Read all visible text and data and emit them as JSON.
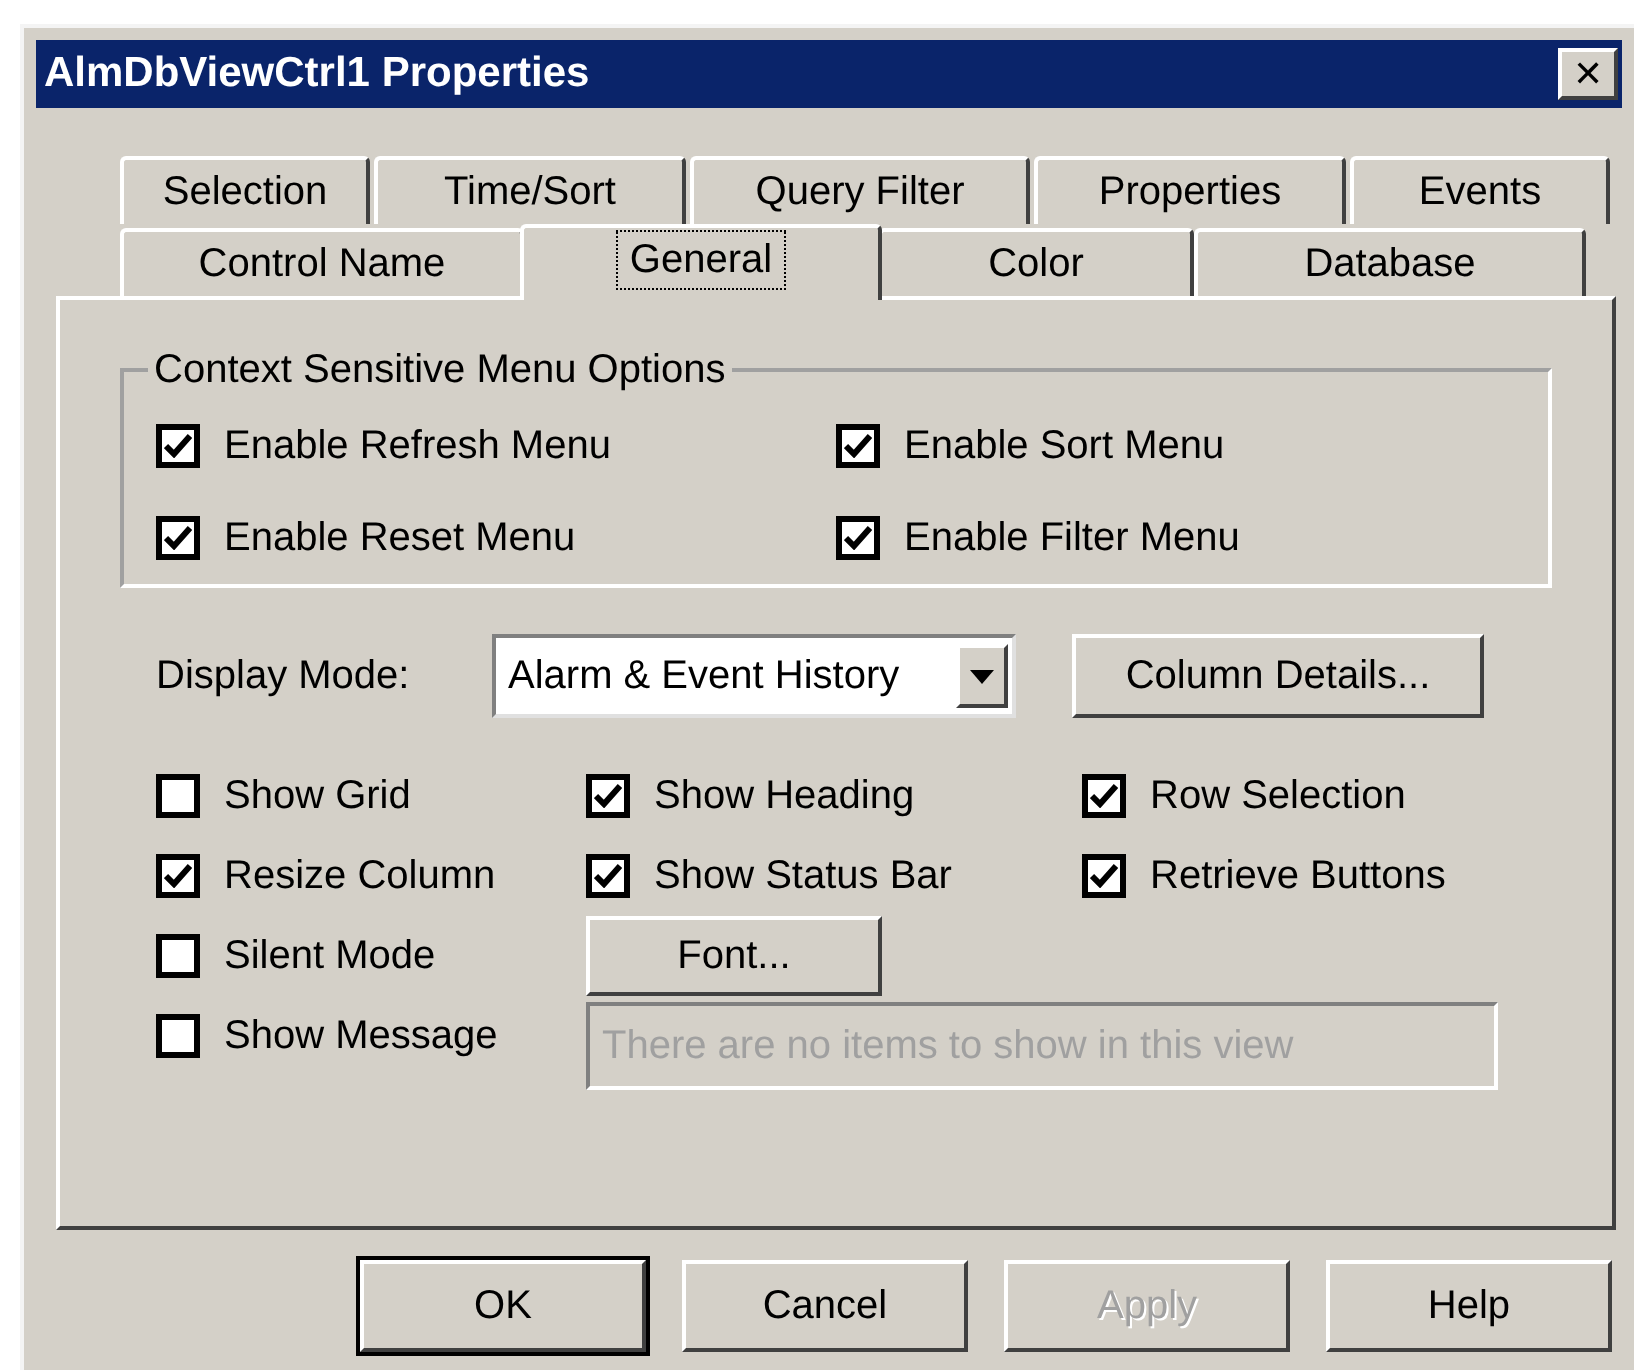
{
  "window": {
    "title": "AlmDbViewCtrl1 Properties",
    "close": "✕"
  },
  "tab_rows": [
    [
      {
        "label": "Selection",
        "selected": false
      },
      {
        "label": "Time/Sort",
        "selected": false
      },
      {
        "label": "Query Filter",
        "selected": false
      },
      {
        "label": "Properties",
        "selected": false
      },
      {
        "label": "Events",
        "selected": false
      }
    ],
    [
      {
        "label": "Control Name",
        "selected": false
      },
      {
        "label": "General",
        "selected": true
      },
      {
        "label": "Color",
        "selected": false
      },
      {
        "label": "Database",
        "selected": false
      }
    ]
  ],
  "menu_options": {
    "title": "Context Sensitive Menu Options",
    "items": [
      {
        "label": "Enable Refresh Menu",
        "checked": true
      },
      {
        "label": "Enable Sort Menu",
        "checked": true
      },
      {
        "label": "Enable Reset Menu",
        "checked": true
      },
      {
        "label": "Enable Filter Menu",
        "checked": true
      }
    ]
  },
  "display_mode": {
    "label": "Display Mode:",
    "value": "Alarm & Event History",
    "button": {
      "label": "Column Details..."
    }
  },
  "options": [
    {
      "kind": "checkbox",
      "label": "Show Grid",
      "checked": false
    },
    {
      "kind": "checkbox",
      "label": "Show Heading",
      "checked": true
    },
    {
      "kind": "checkbox",
      "label": "Row Selection",
      "checked": true
    },
    {
      "kind": "checkbox",
      "label": "Resize Column",
      "checked": true
    },
    {
      "kind": "checkbox",
      "label": "Show Status Bar",
      "checked": true
    },
    {
      "kind": "checkbox",
      "label": "Retrieve Buttons",
      "checked": true
    },
    {
      "kind": "checkbox",
      "label": "Silent Mode",
      "checked": false
    },
    {
      "kind": "button",
      "label": "Font..."
    },
    {
      "kind": "checkbox",
      "label": "Show Message",
      "checked": false
    },
    {
      "kind": "field",
      "placeholder": "There are no items to show in this view",
      "disabled": true
    }
  ],
  "buttons": [
    {
      "label": "OK",
      "default": true,
      "disabled": false
    },
    {
      "label": "Cancel",
      "default": false,
      "disabled": false
    },
    {
      "label": "Apply",
      "default": false,
      "disabled": true
    },
    {
      "label": "Help",
      "default": false,
      "disabled": false
    }
  ]
}
